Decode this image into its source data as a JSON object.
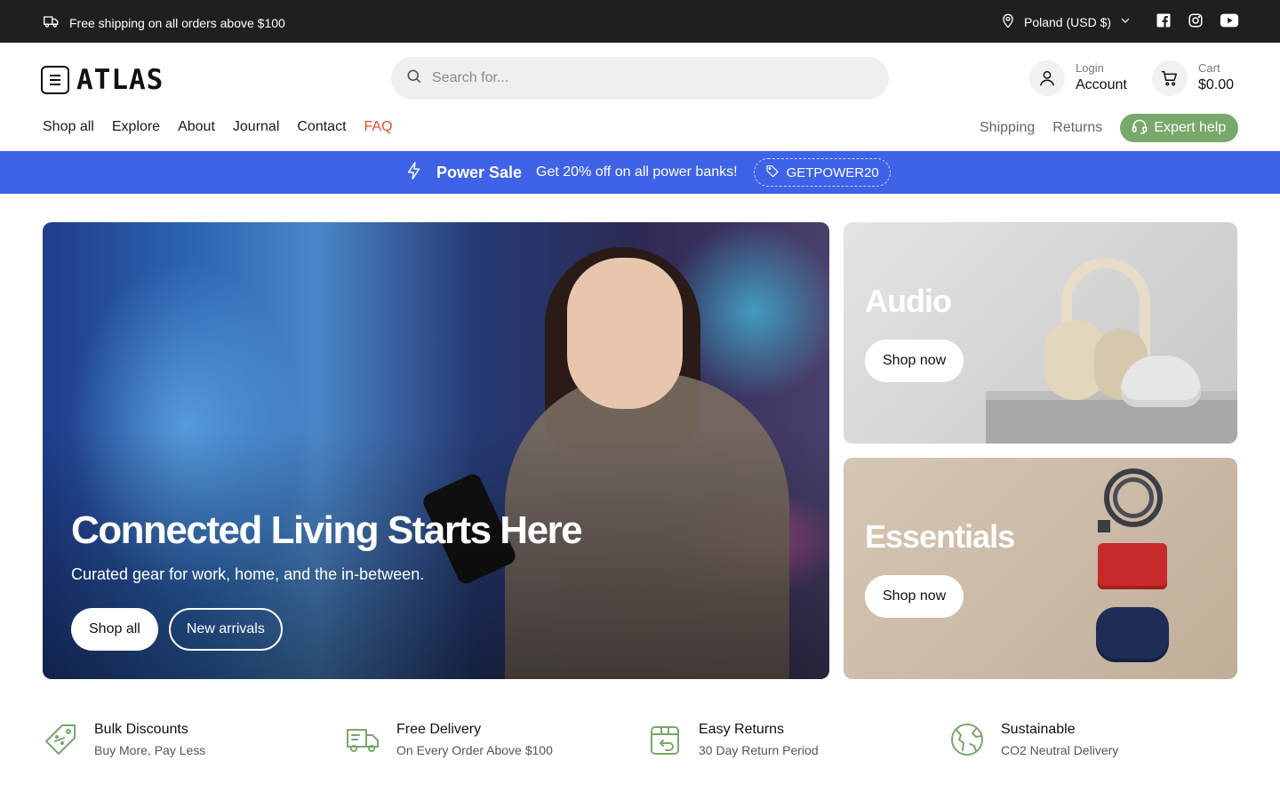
{
  "topbar": {
    "shipping_text": "Free shipping on all orders above $100",
    "region": "Poland (USD $)",
    "social_icons": [
      "facebook-icon",
      "instagram-icon",
      "youtube-icon"
    ]
  },
  "header": {
    "logo_text": "ATLAS",
    "search_placeholder": "Search for...",
    "account": {
      "small": "Login",
      "big": "Account"
    },
    "cart": {
      "small": "Cart",
      "big": "$0.00"
    },
    "nav": [
      "Shop all",
      "Explore",
      "About",
      "Journal",
      "Contact",
      "FAQ"
    ],
    "nav_right": [
      "Shipping",
      "Returns"
    ],
    "expert_help": "Expert help"
  },
  "promo": {
    "title": "Power Sale",
    "message": "Get 20% off on all power banks!",
    "code": "GETPOWER20"
  },
  "hero": {
    "title": "Connected Living Starts Here",
    "subtitle": "Curated gear for work, home, and the in-between.",
    "primary_button": "Shop all",
    "secondary_button": "New arrivals"
  },
  "cards": [
    {
      "title": "Audio",
      "button": "Shop now"
    },
    {
      "title": "Essentials",
      "button": "Shop now"
    }
  ],
  "features": [
    {
      "title": "Bulk Discounts",
      "subtitle": "Buy More, Pay Less",
      "icon": "discount-tag-icon"
    },
    {
      "title": "Free Delivery",
      "subtitle": "On Every Order Above $100",
      "icon": "truck-icon"
    },
    {
      "title": "Easy Returns",
      "subtitle": "30 Day Return Period",
      "icon": "return-box-icon"
    },
    {
      "title": "Sustainable",
      "subtitle": "CO2 Neutral Delivery",
      "icon": "globe-icon"
    }
  ],
  "colors": {
    "topbar_bg": "#1f1f1f",
    "promo_bg": "#3e62e8",
    "faq_accent": "#e3502b",
    "expert_green": "#78a86b",
    "feature_icon_green": "#78a86b"
  }
}
